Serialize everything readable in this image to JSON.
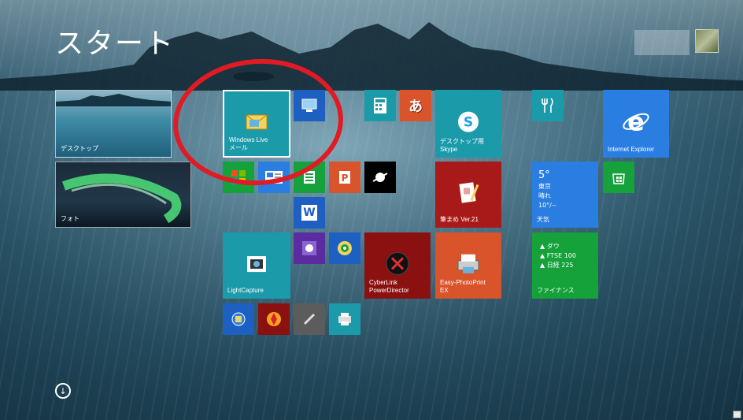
{
  "screen": {
    "title": "スタート"
  },
  "colors": {
    "teal": "#1b9aaa",
    "dark_red": "#a81a1a",
    "orange": "#d9532b",
    "blue": "#2a7de1",
    "green": "#15a23a",
    "annotation_red": "#e01b24"
  },
  "tiles": {
    "desktop": {
      "label": "デスクトップ"
    },
    "photos": {
      "label": "フォト"
    },
    "windows_live_mail": {
      "label": "Windows Live\nメール"
    },
    "skype": {
      "label": "デスクトップ用\nSkype"
    },
    "internet_explorer": {
      "label": "Internet Explorer"
    },
    "weather": {
      "temp": "5°",
      "city": "東京",
      "condition": "晴れ",
      "range": "10°/--",
      "label": "天気"
    },
    "hikkei": {
      "label": "筆まめ Ver.21"
    },
    "lightcapture": {
      "label": "LightCapture"
    },
    "powerdirector": {
      "label": "CyberLink\nPowerDirector"
    },
    "photoprint": {
      "label": "Easy-PhotoPrint\nEX"
    },
    "finance": {
      "row1": "▲ ダウ",
      "row2": "▲ FTSE 100",
      "row3": "▲ 日経 225",
      "label": "ファイナンス"
    },
    "word_letter": "W",
    "hiragana": "あ"
  }
}
